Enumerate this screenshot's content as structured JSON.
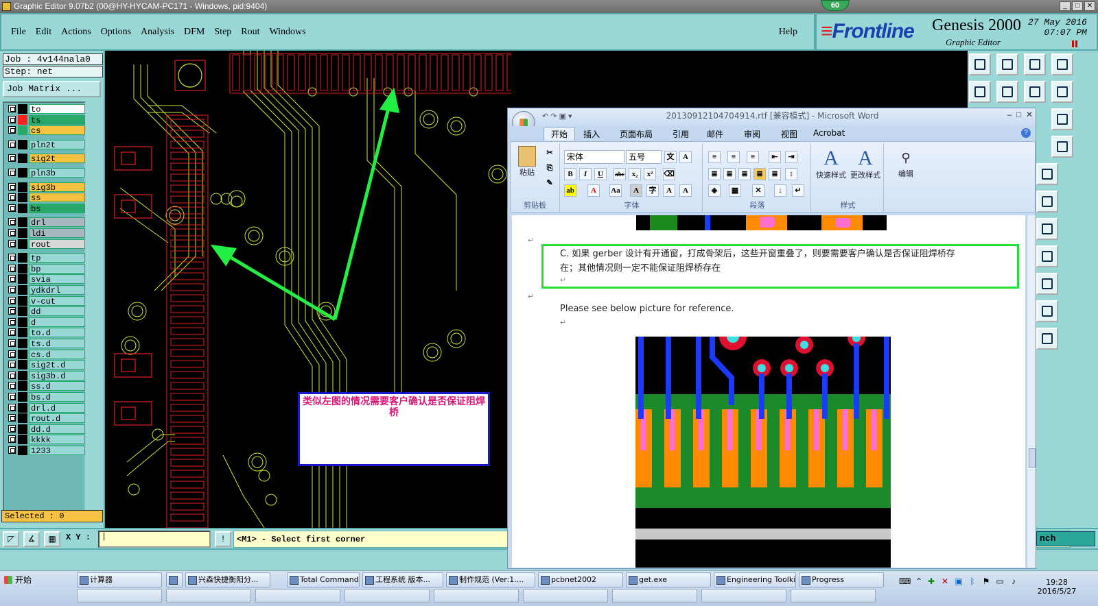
{
  "titlebar": {
    "title": "Graphic Editor 9.07b2 (00@HY-HYCAM-PC171 - Windows, pid:9404)",
    "badge": "60"
  },
  "menu": [
    "File",
    "Edit",
    "Actions",
    "Options",
    "Analysis",
    "DFM",
    "Step",
    "Rout",
    "Windows"
  ],
  "help": "Help",
  "brand": {
    "logo": "Frontline",
    "product": "Genesis 2000",
    "subtitle": "Graphic Editor",
    "date": "27 May 2016",
    "time": "07:07 PM"
  },
  "job": {
    "job": "Job : 4v144nala0",
    "step": "Step: net",
    "matrix_button": "Job Matrix ..."
  },
  "layers": [
    {
      "name": "to",
      "color": "#ffffff",
      "swatch": "#000000"
    },
    {
      "name": "ts",
      "color": "#2aa86a",
      "swatch": "#ff2020"
    },
    {
      "name": "cs",
      "color": "#f5c242",
      "swatch": "#2aa86a"
    },
    {
      "name": "pln2t",
      "color": "#9ad8d8",
      "swatch": "#000000"
    },
    {
      "name": "sig2t",
      "color": "#f5c242",
      "swatch": "#000000"
    },
    {
      "name": "pln3b",
      "color": "#9ad8d8",
      "swatch": "#000000"
    },
    {
      "name": "sig3b",
      "color": "#f5c242",
      "swatch": "#000000"
    },
    {
      "name": "ss",
      "color": "#f5c242",
      "swatch": "#000000"
    },
    {
      "name": "bs",
      "color": "#2aa86a",
      "swatch": "#000000"
    },
    {
      "name": "drl",
      "color": "#a8b8c0",
      "swatch": "#000000"
    },
    {
      "name": "ldi",
      "color": "#a8b8c0",
      "swatch": "#000000"
    },
    {
      "name": "rout",
      "color": "#d8d8d8",
      "swatch": "#000000"
    },
    {
      "name": "tp",
      "color": "#9ad8d8",
      "swatch": "#000000"
    },
    {
      "name": "bp",
      "color": "#9ad8d8",
      "swatch": "#000000"
    },
    {
      "name": "svia",
      "color": "#9ad8d8",
      "swatch": "#000000"
    },
    {
      "name": "ydkdrl",
      "color": "#9ad8d8",
      "swatch": "#000000"
    },
    {
      "name": "v-cut",
      "color": "#9ad8d8",
      "swatch": "#000000"
    },
    {
      "name": "dd",
      "color": "#9ad8d8",
      "swatch": "#000000"
    },
    {
      "name": "d",
      "color": "#9ad8d8",
      "swatch": "#000000"
    },
    {
      "name": "to.d",
      "color": "#9ad8d8",
      "swatch": "#000000"
    },
    {
      "name": "ts.d",
      "color": "#9ad8d8",
      "swatch": "#000000"
    },
    {
      "name": "cs.d",
      "color": "#9ad8d8",
      "swatch": "#000000"
    },
    {
      "name": "sig2t.d",
      "color": "#9ad8d8",
      "swatch": "#000000"
    },
    {
      "name": "sig3b.d",
      "color": "#9ad8d8",
      "swatch": "#000000"
    },
    {
      "name": "ss.d",
      "color": "#9ad8d8",
      "swatch": "#000000"
    },
    {
      "name": "bs.d",
      "color": "#9ad8d8",
      "swatch": "#000000"
    },
    {
      "name": "drl.d",
      "color": "#9ad8d8",
      "swatch": "#000000"
    },
    {
      "name": "rout.d",
      "color": "#9ad8d8",
      "swatch": "#000000"
    },
    {
      "name": "dd.d",
      "color": "#9ad8d8",
      "swatch": "#000000"
    },
    {
      "name": "kkkk",
      "color": "#9ad8d8",
      "swatch": "#000000"
    },
    {
      "name": "1233",
      "color": "#9ad8d8",
      "swatch": "#000000"
    }
  ],
  "selected": "Selected : 0",
  "canvas_note": "类似左图的情况需要客户确认是否保证阻焊桥",
  "status": {
    "xy_label": "X Y :",
    "prompt": "<M1> - Select first corner",
    "branch": "nch"
  },
  "word": {
    "title": "20130912104704914.rtf [兼容模式] - Microsoft Word",
    "tabs": [
      "开始",
      "插入",
      "页面布局",
      "引用",
      "邮件",
      "审阅",
      "视图",
      "Acrobat"
    ],
    "groups": [
      "剪贴板",
      "字体",
      "段落",
      "样式"
    ],
    "paste": "粘贴",
    "font": "宋体",
    "size": "五号",
    "quick_styles": "快速样式",
    "change_styles": "更改样式",
    "edit": "编辑",
    "para_c_line1": "C. 如果 gerber 设计有开通窗，打成骨架后，这些开窗重叠了，则要需要客户确认是否保证阻焊桥存",
    "para_c_line2": "在；其他情况则一定不能保证阻焊桥存在",
    "reference": "Please see below picture for reference."
  },
  "taskbar": {
    "start": "开始",
    "items": [
      "计算器",
      "",
      "兴森快捷衡阳分...",
      "Total Commander ...",
      "工程系统  版本...",
      "制作规范 (Ver:1....",
      "pcbnet2002",
      "get.exe",
      "Engineering Toolki...",
      "Progress"
    ],
    "clock_time": "19:28",
    "clock_date": "2016/5/27"
  }
}
